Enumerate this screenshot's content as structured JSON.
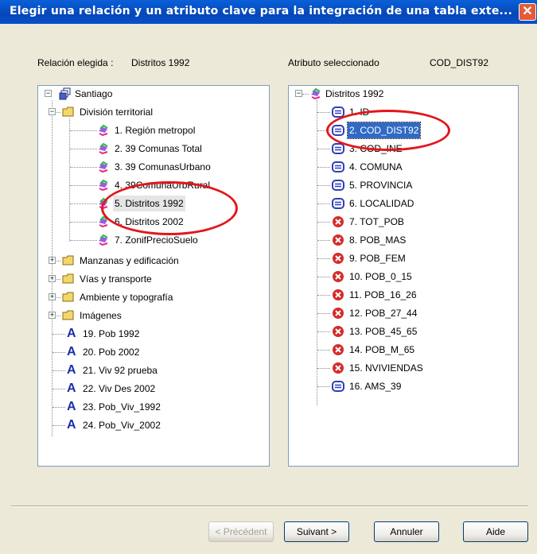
{
  "window": {
    "title": "Elegir una relación y un atributo clave para la integración de una tabla exte...",
    "close_label": "✕"
  },
  "relation_label": "Relación elegida :",
  "relation_value": "Distritos 1992",
  "attribute_label": "Atributo seleccionado",
  "attribute_value": "COD_DIST92",
  "left_tree": {
    "root": "Santiago",
    "territorial": "División territorial",
    "territorial_items": [
      "1. Región metropol",
      "2. 39 Comunas Total",
      "3. 39 ComunasUrbano",
      "4. 39ComunaUrbRural",
      "5. Distritos 1992",
      "6. Distritos 2002",
      "7. ZonifPrecioSuelo"
    ],
    "folders": [
      "Manzanas y edificación",
      "Vías y transporte",
      "Ambiente y topografía",
      "Imágenes"
    ],
    "layers": [
      "19. Pob 1992",
      "20. Pob 2002",
      "21. Viv 92 prueba",
      "22. Viv Des 2002",
      "23. Pob_Viv_1992",
      "24. Pob_Viv_2002"
    ]
  },
  "right_tree": {
    "root": "Distritos 1992",
    "attributes": [
      "1. ID",
      "2. COD_DIST92",
      "3. COD_INE",
      "4. COMUNA",
      "5. PROVINCIA",
      "6. LOCALIDAD",
      "7. TOT_POB",
      "8. POB_MAS",
      "9. POB_FEM",
      "10. POB_0_15",
      "11. POB_16_26",
      "12. POB_27_44",
      "13. POB_45_65",
      "14. POB_M_65",
      "15. NVIVIENDAS",
      "16. AMS_39"
    ]
  },
  "buttons": {
    "previous": "< Précédent",
    "next": "Suivant >",
    "cancel": "Annuler",
    "help": "Aide"
  },
  "colors": {
    "selection": "#316ac5",
    "annotation_circle": "#e3161b",
    "titlebar": "#0547b8"
  }
}
